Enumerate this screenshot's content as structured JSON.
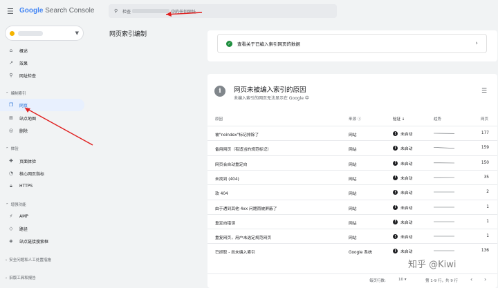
{
  "app": {
    "logo_google": "Google",
    "logo_product": "Search Console"
  },
  "search": {
    "prefix": "检查",
    "suffix": "中的任何网址"
  },
  "sidebar": {
    "top": [
      {
        "label": "概述",
        "icon": "home-icon"
      },
      {
        "label": "效果",
        "icon": "trend-icon"
      },
      {
        "label": "网址检查",
        "icon": "search-icon"
      }
    ],
    "sections": [
      {
        "title": "编制索引",
        "items": [
          {
            "label": "网页",
            "icon": "pages-icon"
          },
          {
            "label": "站点地图",
            "icon": "sitemap-icon"
          },
          {
            "label": "删除",
            "icon": "removal-icon"
          }
        ]
      },
      {
        "title": "体验",
        "items": [
          {
            "label": "页面体验",
            "icon": "experience-icon"
          },
          {
            "label": "核心网页指标",
            "icon": "gauge-icon"
          },
          {
            "label": "HTTPS",
            "icon": "lock-icon"
          }
        ]
      },
      {
        "title": "增强功能",
        "items": [
          {
            "label": "AMP",
            "icon": "amp-icon"
          },
          {
            "label": "路径",
            "icon": "breadcrumb-icon"
          },
          {
            "label": "站点链接搜索框",
            "icon": "sitelinks-icon"
          }
        ]
      }
    ],
    "collapsed": [
      "安全问题和人工处置措施",
      "旧版工具和报告"
    ]
  },
  "page": {
    "title": "网页索引编制"
  },
  "indexed_card": {
    "label": "查看关于已编入索引网页的数据"
  },
  "reasons_card": {
    "title": "网页未被编入索引的原因",
    "subtitle": "未编入索引的网页无法显示在 Google 中"
  },
  "table": {
    "headers": {
      "reason": "原因",
      "source": "来源",
      "validation": "验证",
      "trend": "趋势",
      "pages": "网页"
    },
    "rows": [
      {
        "reason": "被\"noindex\"标记排除了",
        "source": "网站",
        "validation": "未启动",
        "pages": "177"
      },
      {
        "reason": "备用网页（有适当的规范标记）",
        "source": "网站",
        "validation": "未启动",
        "pages": "159"
      },
      {
        "reason": "网页会自动重定向",
        "source": "网站",
        "validation": "未启动",
        "pages": "150"
      },
      {
        "reason": "未找到 (404)",
        "source": "网站",
        "validation": "未启动",
        "pages": "35"
      },
      {
        "reason": "软 404",
        "source": "网站",
        "validation": "未启动",
        "pages": "2"
      },
      {
        "reason": "由于遇到其他 4xx 问题而被屏蔽了",
        "source": "网站",
        "validation": "未启动",
        "pages": "1"
      },
      {
        "reason": "重定向错误",
        "source": "网站",
        "validation": "未启动",
        "pages": "1"
      },
      {
        "reason": "重复网页，用户未选定规范网页",
        "source": "网站",
        "validation": "未启动",
        "pages": "1"
      },
      {
        "reason": "已抓取 - 尚未编入索引",
        "source": "Google 系统",
        "validation": "未启动",
        "pages": "136"
      }
    ]
  },
  "footer": {
    "rows_per_page_label": "每页行数:",
    "rows_per_page": "10",
    "range": "第 1-9 行，共 9 行"
  },
  "watermark": "知乎 @Kiwi"
}
